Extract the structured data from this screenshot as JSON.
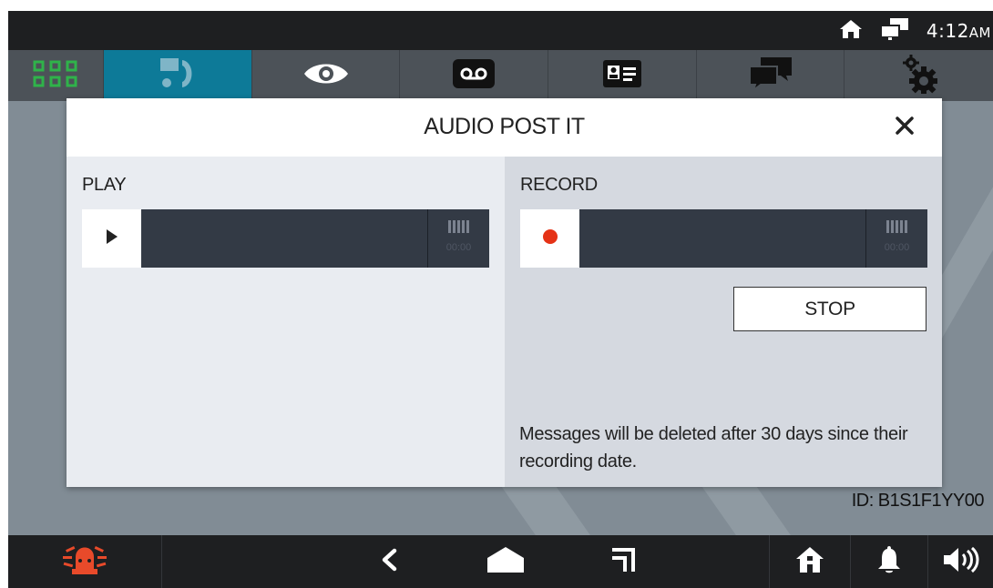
{
  "status_bar": {
    "icons": [
      "home-icon",
      "network-icon"
    ],
    "time": "4:12",
    "ampm": "AM"
  },
  "tabs": [
    {
      "icon": "grid-icon",
      "active": false
    },
    {
      "icon": "intercom-phone-icon",
      "active": true
    },
    {
      "icon": "eye-icon",
      "active": false
    },
    {
      "icon": "voicemail-icon",
      "active": false
    },
    {
      "icon": "contact-card-icon",
      "active": false
    },
    {
      "icon": "chat-bubbles-icon",
      "active": false
    },
    {
      "icon": "settings-gears-icon",
      "active": false
    }
  ],
  "dialog": {
    "title": "AUDIO POST IT",
    "close_icon": "close-icon",
    "play": {
      "label": "PLAY",
      "button_icon": "play-icon",
      "meter_icon": "level-meter-icon",
      "time": "00:00"
    },
    "record": {
      "label": "RECORD",
      "button_icon": "record-dot-icon",
      "meter_icon": "level-meter-icon",
      "time": "00:00",
      "stop_label": "STOP",
      "notice": "Messages will be deleted after 30 days since their recording date."
    }
  },
  "device_id": "ID: B1S1F1YY00",
  "nav_bar": {
    "icons": [
      "alarm-icon",
      "back-icon",
      "home-shape-icon",
      "recent-icon",
      "house-icon",
      "bell-icon",
      "volume-icon"
    ]
  },
  "colors": {
    "active_tab": "#0d7a98",
    "grid_icon": "#2fb34a",
    "record_dot": "#e53216",
    "alarm_icon": "#e84a2a"
  }
}
